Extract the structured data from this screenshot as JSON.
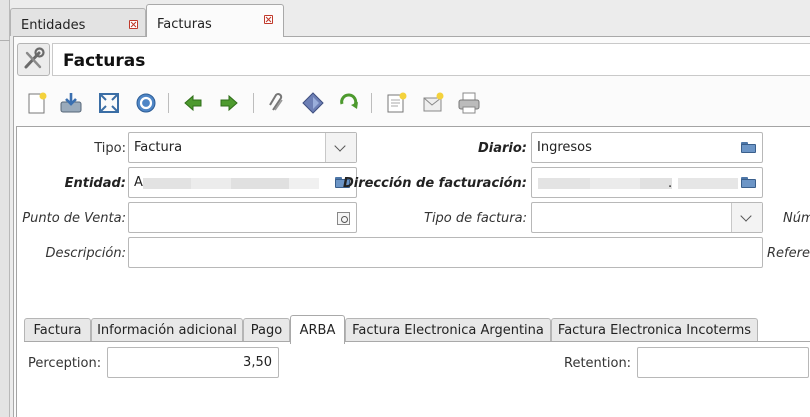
{
  "document_tabs": [
    {
      "label": "Entidades",
      "active": false
    },
    {
      "label": "Facturas",
      "active": true
    }
  ],
  "window_title": "Facturas",
  "toolbar": {
    "buttons": [
      "new-document-icon",
      "save-icon",
      "fullscreen-icon",
      "reload-icon",
      "previous-icon",
      "next-icon",
      "attachment-icon",
      "action-icon",
      "relate-icon",
      "report-icon",
      "email-icon",
      "print-icon"
    ]
  },
  "form": {
    "tipo": {
      "label": "Tipo:",
      "value": "Factura"
    },
    "diario": {
      "label": "Diario:",
      "value": "Ingresos"
    },
    "entidad": {
      "label": "Entidad:",
      "value": "A"
    },
    "direccion": {
      "label": "Dirección de facturación:",
      "value": "."
    },
    "punto_venta": {
      "label": "Punto de Venta:",
      "value": ""
    },
    "tipo_factura": {
      "label": "Tipo de factura:",
      "value": ""
    },
    "numero": {
      "label": "Núm"
    },
    "descripcion": {
      "label": "Descripción:",
      "value": ""
    },
    "referencia": {
      "label": "Refere"
    }
  },
  "inner_tabs": [
    {
      "label": "Factura",
      "active": false
    },
    {
      "label": "Información adicional",
      "active": false
    },
    {
      "label": "Pago",
      "active": false
    },
    {
      "label": "ARBA",
      "active": true
    },
    {
      "label": "Factura Electronica Argentina",
      "active": false
    },
    {
      "label": "Factura Electronica Incoterms",
      "active": false
    }
  ],
  "arba": {
    "perception": {
      "label": "Perception:",
      "value": "3,50"
    },
    "retention": {
      "label": "Retention:",
      "value": ""
    }
  }
}
